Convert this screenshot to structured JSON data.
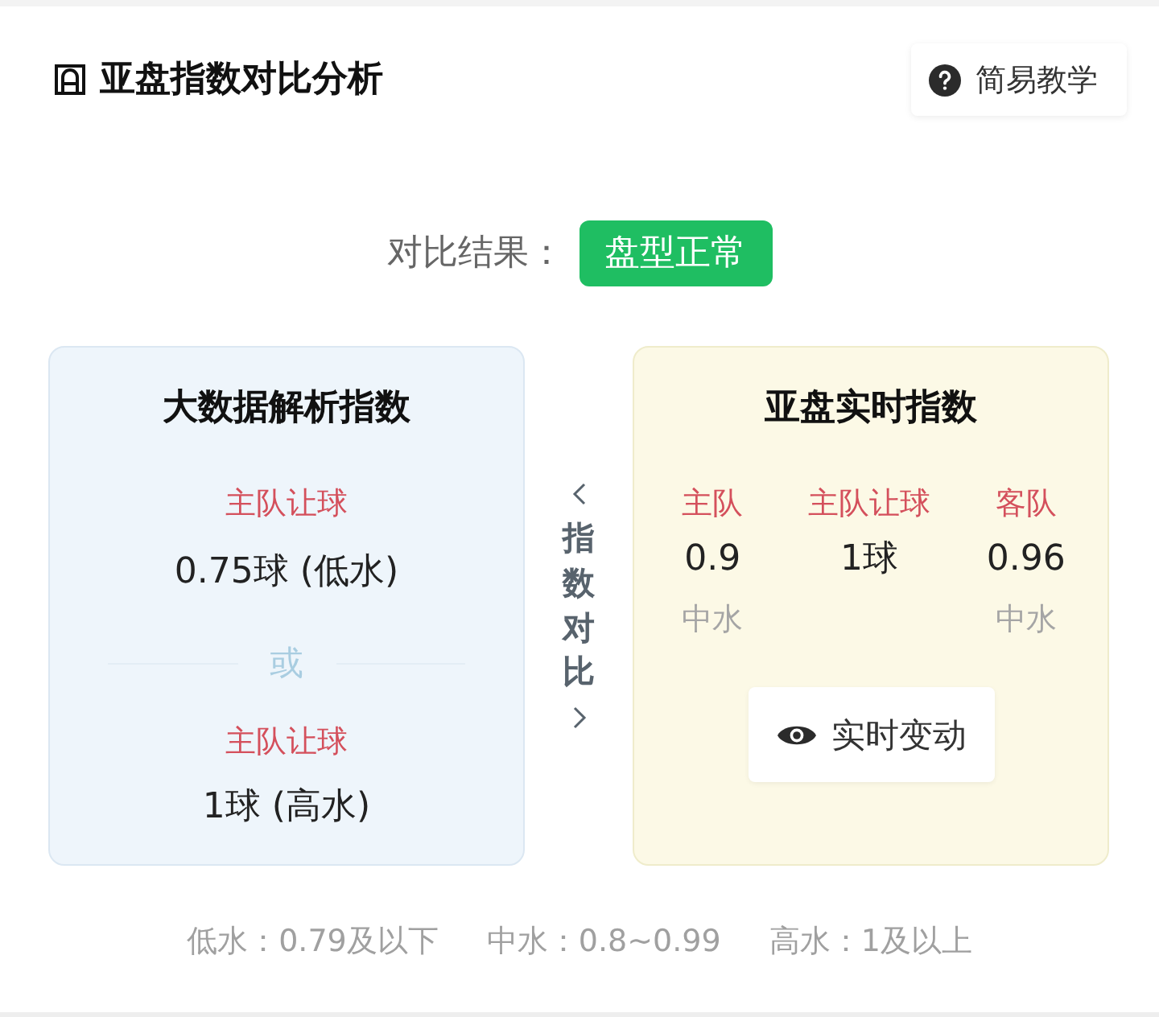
{
  "header": {
    "title": "亚盘指数对比分析",
    "help_button": "简易教学"
  },
  "result": {
    "label": "对比结果：",
    "badge": "盘型正常"
  },
  "analysis_card": {
    "title": "大数据解析指数",
    "options": [
      {
        "label": "主队让球",
        "value": "0.75球 (低水)"
      },
      {
        "label": "主队让球",
        "value": "1球 (高水)"
      }
    ],
    "separator": "或"
  },
  "compare_toggle": {
    "text": "指数对比"
  },
  "live_card": {
    "title": "亚盘实时指数",
    "columns": [
      {
        "heading": "主队",
        "value": "0.9",
        "note": "中水"
      },
      {
        "heading": "主队让球",
        "value": "1球"
      },
      {
        "heading": "客队",
        "value": "0.96",
        "note": "中水"
      }
    ],
    "button": "实时变动"
  },
  "legend": [
    "低水：0.79及以下",
    "中水：0.8~0.99",
    "高水：1及以上"
  ]
}
